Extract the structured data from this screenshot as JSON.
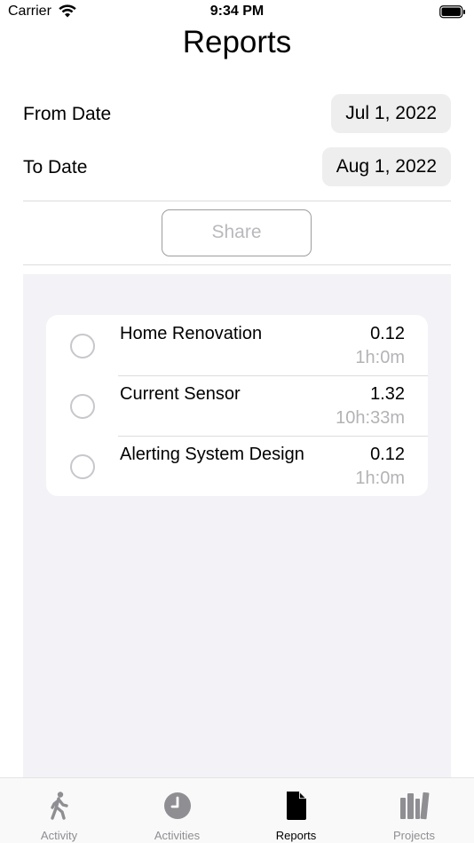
{
  "status_bar": {
    "carrier": "Carrier",
    "time": "9:34 PM"
  },
  "title": "Reports",
  "filters": {
    "from_label": "From Date",
    "from_value": "Jul 1, 2022",
    "to_label": "To Date",
    "to_value": "Aug 1, 2022"
  },
  "share_label": "Share",
  "projects": [
    {
      "name": "Home Renovation",
      "value": "0.12",
      "duration": "1h:0m"
    },
    {
      "name": "Current Sensor",
      "value": "1.32",
      "duration": "10h:33m"
    },
    {
      "name": "Alerting System Design",
      "value": "0.12",
      "duration": "1h:0m"
    }
  ],
  "tabs": [
    {
      "label": "Activity",
      "icon": "walking-figure-icon"
    },
    {
      "label": "Activities",
      "icon": "clock-icon"
    },
    {
      "label": "Reports",
      "icon": "document-icon",
      "active": true
    },
    {
      "label": "Projects",
      "icon": "books-icon"
    }
  ],
  "colors": {
    "inactive_tab": "#8e8e93",
    "active_tab": "#000000",
    "grouped_background": "#f2f2f7"
  }
}
